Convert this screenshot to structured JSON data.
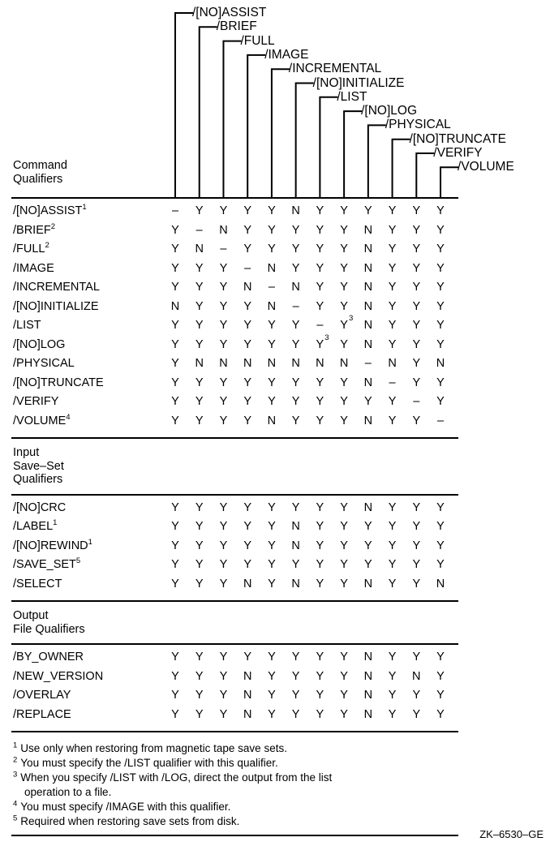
{
  "figure": {
    "id_label": "ZK–6530–GE",
    "corner_title_lines": [
      "Command",
      "Qualifiers"
    ]
  },
  "columns": [
    "/[NO]ASSIST",
    "/BRIEF",
    "/FULL",
    "/IMAGE",
    "/INCREMENTAL",
    "/[NO]INITIALIZE",
    "/LIST",
    "/[NO]LOG",
    "/PHYSICAL",
    "/[NO]TRUNCATE",
    "/VERIFY",
    "/VOLUME"
  ],
  "sections": [
    {
      "heading_lines": [
        "Command",
        "Qualifiers"
      ],
      "heading_is_corner": true,
      "rows": [
        {
          "label": "/[NO]ASSIST",
          "footnote": "1",
          "values": [
            "–",
            "Y",
            "Y",
            "Y",
            "Y",
            "N",
            "Y",
            "Y",
            "Y",
            "Y",
            "Y",
            "Y"
          ],
          "value_footnotes": [
            "",
            "",
            "",
            "",
            "",
            "",
            "",
            "",
            "",
            "",
            "",
            ""
          ]
        },
        {
          "label": "/BRIEF",
          "footnote": "2",
          "values": [
            "Y",
            "–",
            "N",
            "Y",
            "Y",
            "Y",
            "Y",
            "Y",
            "N",
            "Y",
            "Y",
            "Y"
          ],
          "value_footnotes": [
            "",
            "",
            "",
            "",
            "",
            "",
            "",
            "",
            "",
            "",
            "",
            ""
          ]
        },
        {
          "label": "/FULL",
          "footnote": "2",
          "values": [
            "Y",
            "N",
            "–",
            "Y",
            "Y",
            "Y",
            "Y",
            "Y",
            "N",
            "Y",
            "Y",
            "Y"
          ],
          "value_footnotes": [
            "",
            "",
            "",
            "",
            "",
            "",
            "",
            "",
            "",
            "",
            "",
            ""
          ]
        },
        {
          "label": "/IMAGE",
          "footnote": "",
          "values": [
            "Y",
            "Y",
            "Y",
            "–",
            "N",
            "Y",
            "Y",
            "Y",
            "N",
            "Y",
            "Y",
            "Y"
          ],
          "value_footnotes": [
            "",
            "",
            "",
            "",
            "",
            "",
            "",
            "",
            "",
            "",
            "",
            ""
          ]
        },
        {
          "label": "/INCREMENTAL",
          "footnote": "",
          "values": [
            "Y",
            "Y",
            "Y",
            "N",
            "–",
            "N",
            "Y",
            "Y",
            "N",
            "Y",
            "Y",
            "Y"
          ],
          "value_footnotes": [
            "",
            "",
            "",
            "",
            "",
            "",
            "",
            "",
            "",
            "",
            "",
            ""
          ]
        },
        {
          "label": "/[NO]INITIALIZE",
          "footnote": "",
          "values": [
            "N",
            "Y",
            "Y",
            "Y",
            "N",
            "–",
            "Y",
            "Y",
            "N",
            "Y",
            "Y",
            "Y"
          ],
          "value_footnotes": [
            "",
            "",
            "",
            "",
            "",
            "",
            "",
            "",
            "",
            "",
            "",
            ""
          ]
        },
        {
          "label": "/LIST",
          "footnote": "",
          "values": [
            "Y",
            "Y",
            "Y",
            "Y",
            "Y",
            "Y",
            "–",
            "Y",
            "N",
            "Y",
            "Y",
            "Y"
          ],
          "value_footnotes": [
            "",
            "",
            "",
            "",
            "",
            "",
            "",
            "3",
            "",
            "",
            "",
            ""
          ]
        },
        {
          "label": "/[NO]LOG",
          "footnote": "",
          "values": [
            "Y",
            "Y",
            "Y",
            "Y",
            "Y",
            "Y",
            "Y",
            "Y",
            "N",
            "Y",
            "Y",
            "Y"
          ],
          "value_footnotes": [
            "",
            "",
            "",
            "",
            "",
            "",
            "3",
            "",
            "",
            "",
            "",
            ""
          ]
        },
        {
          "label": "/PHYSICAL",
          "footnote": "",
          "values": [
            "Y",
            "N",
            "N",
            "N",
            "N",
            "N",
            "N",
            "N",
            "–",
            "N",
            "Y",
            "N"
          ],
          "value_footnotes": [
            "",
            "",
            "",
            "",
            "",
            "",
            "",
            "",
            "",
            "",
            "",
            ""
          ]
        },
        {
          "label": "/[NO]TRUNCATE",
          "footnote": "",
          "values": [
            "Y",
            "Y",
            "Y",
            "Y",
            "Y",
            "Y",
            "Y",
            "Y",
            "N",
            "–",
            "Y",
            "Y"
          ],
          "value_footnotes": [
            "",
            "",
            "",
            "",
            "",
            "",
            "",
            "",
            "",
            "",
            "",
            ""
          ]
        },
        {
          "label": "/VERIFY",
          "footnote": "",
          "values": [
            "Y",
            "Y",
            "Y",
            "Y",
            "Y",
            "Y",
            "Y",
            "Y",
            "Y",
            "Y",
            "–",
            "Y"
          ],
          "value_footnotes": [
            "",
            "",
            "",
            "",
            "",
            "",
            "",
            "",
            "",
            "",
            "",
            ""
          ]
        },
        {
          "label": "/VOLUME",
          "footnote": "4",
          "values": [
            "Y",
            "Y",
            "Y",
            "Y",
            "N",
            "Y",
            "Y",
            "Y",
            "N",
            "Y",
            "Y",
            "–"
          ],
          "value_footnotes": [
            "",
            "",
            "",
            "",
            "",
            "",
            "",
            "",
            "",
            "",
            "",
            ""
          ]
        }
      ]
    },
    {
      "heading_lines": [
        "Input",
        "Save–Set",
        "Qualifiers"
      ],
      "heading_is_corner": false,
      "rows": [
        {
          "label": "/[NO]CRC",
          "footnote": "",
          "values": [
            "Y",
            "Y",
            "Y",
            "Y",
            "Y",
            "Y",
            "Y",
            "Y",
            "N",
            "Y",
            "Y",
            "Y"
          ],
          "value_footnotes": [
            "",
            "",
            "",
            "",
            "",
            "",
            "",
            "",
            "",
            "",
            "",
            ""
          ]
        },
        {
          "label": "/LABEL",
          "footnote": "1",
          "values": [
            "Y",
            "Y",
            "Y",
            "Y",
            "Y",
            "N",
            "Y",
            "Y",
            "Y",
            "Y",
            "Y",
            "Y"
          ],
          "value_footnotes": [
            "",
            "",
            "",
            "",
            "",
            "",
            "",
            "",
            "",
            "",
            "",
            ""
          ]
        },
        {
          "label": "/[NO]REWIND",
          "footnote": "1",
          "values": [
            "Y",
            "Y",
            "Y",
            "Y",
            "Y",
            "N",
            "Y",
            "Y",
            "Y",
            "Y",
            "Y",
            "Y"
          ],
          "value_footnotes": [
            "",
            "",
            "",
            "",
            "",
            "",
            "",
            "",
            "",
            "",
            "",
            ""
          ]
        },
        {
          "label": "/SAVE_SET",
          "footnote": "5",
          "values": [
            "Y",
            "Y",
            "Y",
            "Y",
            "Y",
            "Y",
            "Y",
            "Y",
            "Y",
            "Y",
            "Y",
            "Y"
          ],
          "value_footnotes": [
            "",
            "",
            "",
            "",
            "",
            "",
            "",
            "",
            "",
            "",
            "",
            ""
          ]
        },
        {
          "label": "/SELECT",
          "footnote": "",
          "values": [
            "Y",
            "Y",
            "Y",
            "N",
            "Y",
            "N",
            "Y",
            "Y",
            "N",
            "Y",
            "Y",
            "N"
          ],
          "value_footnotes": [
            "",
            "",
            "",
            "",
            "",
            "",
            "",
            "",
            "",
            "",
            "",
            ""
          ]
        }
      ]
    },
    {
      "heading_lines": [
        "Output",
        "File Qualifiers"
      ],
      "heading_is_corner": false,
      "rows": [
        {
          "label": "/BY_OWNER",
          "footnote": "",
          "values": [
            "Y",
            "Y",
            "Y",
            "Y",
            "Y",
            "Y",
            "Y",
            "Y",
            "N",
            "Y",
            "Y",
            "Y"
          ],
          "value_footnotes": [
            "",
            "",
            "",
            "",
            "",
            "",
            "",
            "",
            "",
            "",
            "",
            ""
          ]
        },
        {
          "label": "/NEW_VERSION",
          "footnote": "",
          "values": [
            "Y",
            "Y",
            "Y",
            "N",
            "Y",
            "Y",
            "Y",
            "Y",
            "N",
            "Y",
            "N",
            "Y"
          ],
          "value_footnotes": [
            "",
            "",
            "",
            "",
            "",
            "",
            "",
            "",
            "",
            "",
            "",
            ""
          ]
        },
        {
          "label": "/OVERLAY",
          "footnote": "",
          "values": [
            "Y",
            "Y",
            "Y",
            "N",
            "Y",
            "Y",
            "Y",
            "Y",
            "N",
            "Y",
            "Y",
            "Y"
          ],
          "value_footnotes": [
            "",
            "",
            "",
            "",
            "",
            "",
            "",
            "",
            "",
            "",
            "",
            ""
          ]
        },
        {
          "label": "/REPLACE",
          "footnote": "",
          "values": [
            "Y",
            "Y",
            "Y",
            "N",
            "Y",
            "Y",
            "Y",
            "Y",
            "N",
            "Y",
            "Y",
            "Y"
          ],
          "value_footnotes": [
            "",
            "",
            "",
            "",
            "",
            "",
            "",
            "",
            "",
            "",
            "",
            ""
          ]
        }
      ]
    }
  ],
  "footnotes": [
    {
      "mark": "1",
      "text": "Use only when restoring from magnetic tape save sets.",
      "cont": ""
    },
    {
      "mark": "2",
      "text": "You must specify the /LIST qualifier with this qualifier.",
      "cont": ""
    },
    {
      "mark": "3",
      "text": "When you specify /LIST with /LOG, direct the output from the list",
      "cont": "operation to a file."
    },
    {
      "mark": "4",
      "text": "You must specify /IMAGE with this qualifier.",
      "cont": ""
    },
    {
      "mark": "5",
      "text": "Required when restoring save sets from disk.",
      "cont": ""
    }
  ]
}
